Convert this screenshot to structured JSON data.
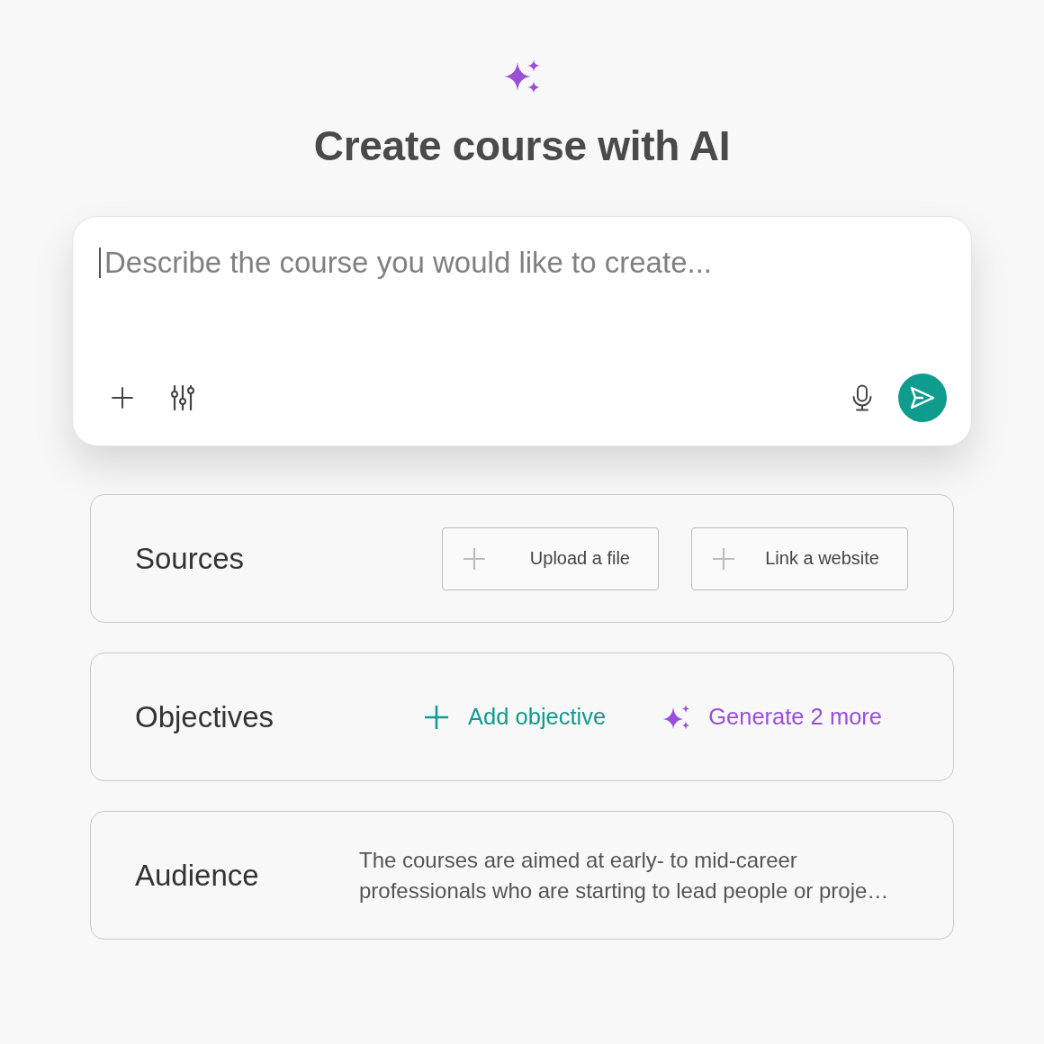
{
  "header": {
    "title": "Create course with AI"
  },
  "prompt": {
    "placeholder": "Describe the course you would like to create..."
  },
  "sections": [
    {
      "kind": "sources",
      "label": "Sources",
      "actions": [
        {
          "label": "Upload a file"
        },
        {
          "label": "Link a website"
        }
      ]
    },
    {
      "kind": "objectives",
      "label": "Objectives",
      "actions": [
        {
          "kind": "add",
          "label": "Add objective"
        },
        {
          "kind": "generate",
          "label": "Generate 2 more"
        }
      ]
    },
    {
      "kind": "audience",
      "label": "Audience",
      "text": "The courses are aimed at early- to mid-career professionals who are starting to lead people or proje…"
    }
  ]
}
